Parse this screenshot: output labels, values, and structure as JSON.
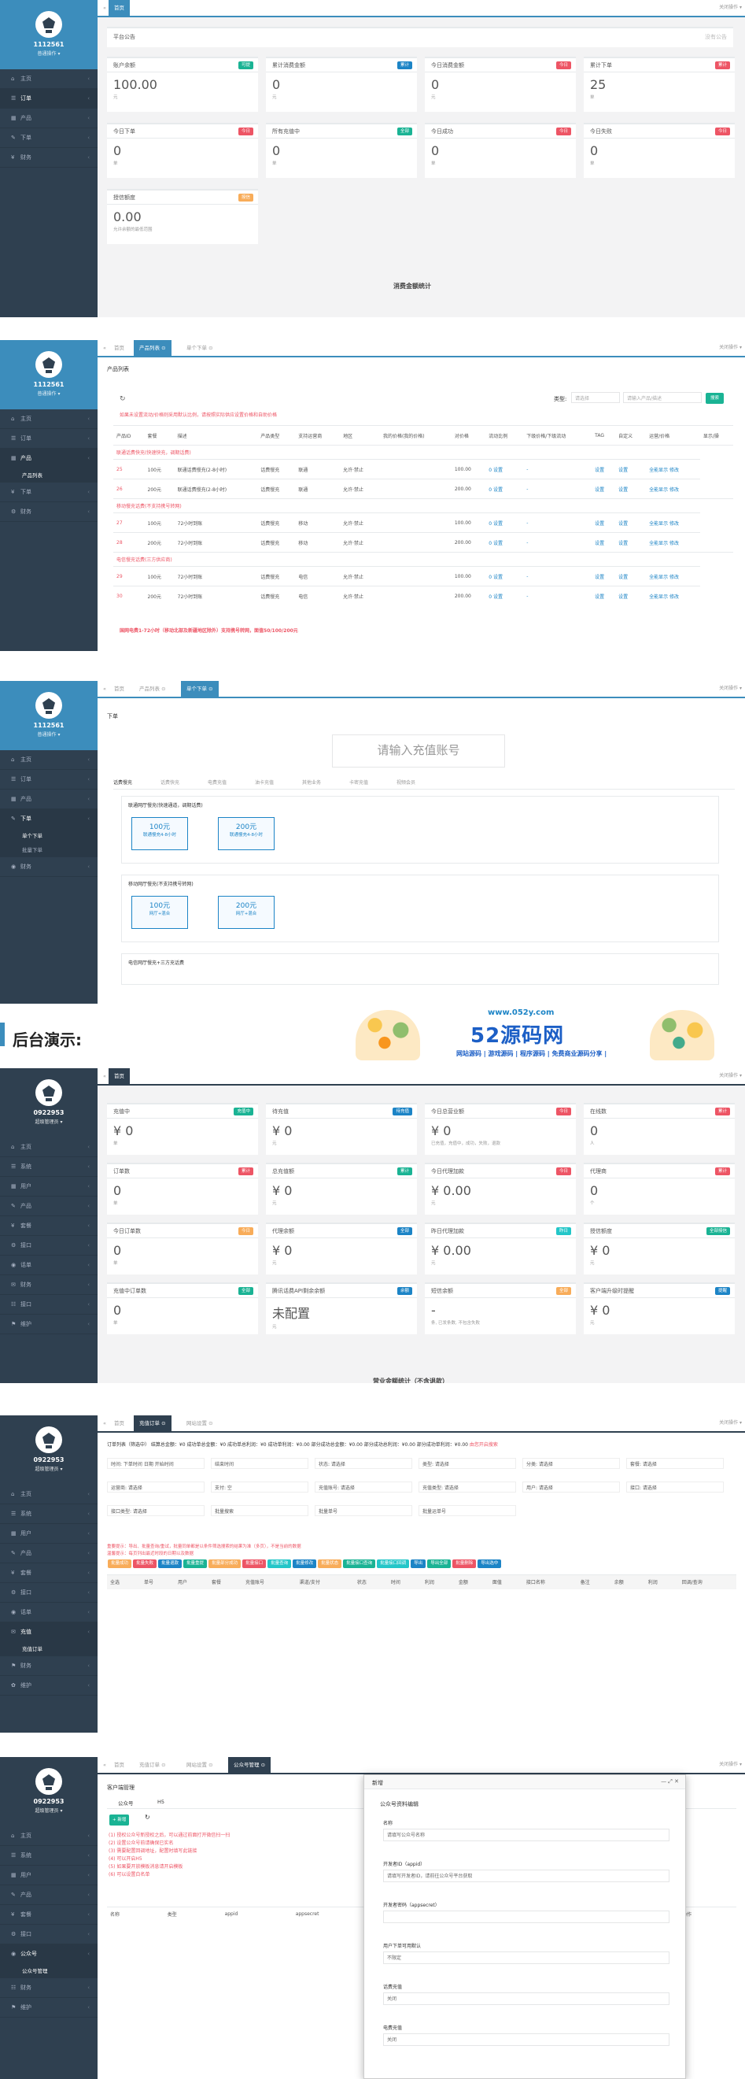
{
  "p1": {
    "user": "1112561",
    "role": "普通操作 ▾",
    "nav": [
      "主页",
      "订单",
      "产品",
      "下单",
      "财务"
    ],
    "tabs": [
      "首页"
    ],
    "tabr": "关闭操作 ▾",
    "notice": "平台公告",
    "notice_r": "没有公告",
    "cards": [
      {
        "t": "账户余额",
        "b": "可提",
        "v": "100.00",
        "s": "元"
      },
      {
        "t": "累计消费金额",
        "b": "累计",
        "v": "0",
        "s": "元"
      },
      {
        "t": "今日消费金额",
        "b": "今日",
        "v": "0",
        "s": "元"
      },
      {
        "t": "累计下单",
        "b": "累计",
        "v": "25",
        "s": "单"
      },
      {
        "t": "今日下单",
        "b": "今日",
        "v": "0",
        "s": "单"
      },
      {
        "t": "所有充值中",
        "b": "全部",
        "v": "0",
        "s": "单"
      },
      {
        "t": "今日成功",
        "b": "今日",
        "v": "0",
        "s": "单"
      },
      {
        "t": "今日失败",
        "b": "今日",
        "v": "0",
        "s": "单"
      },
      {
        "t": "授信额度",
        "b": "授信",
        "v": "0.00",
        "s": "允许余额的最低范围"
      }
    ],
    "footer": "消费金额统计"
  },
  "p2": {
    "user": "1112561",
    "role": "普通操作 ▾",
    "nav": [
      "主页",
      "订单",
      "产品",
      "产品列表",
      "下单",
      "财务"
    ],
    "tabs": [
      "首页",
      "产品列表 ⊙",
      "单个下单 ⊙"
    ],
    "tabr": "关闭操作 ▾",
    "title": "产品列表",
    "type_label": "类型:",
    "type_sel": "请选择",
    "kw": "请输入产品/描述",
    "search": "搜索",
    "warn": "如果未设置流动/价格则采用默认比例，请按照实际供应设置价格和自助价格",
    "headers": [
      "产品ID",
      "套餐",
      "描述",
      "产品类型",
      "支持运营商",
      "地区",
      "我的价格(我的价格)",
      "对价格",
      "流动比例",
      "下级价格/下级流动",
      "TAG",
      "自定义",
      "运营/价格",
      "显示/操"
    ],
    "groups": [
      {
        "name": "联通话费快充(快速快充，调期话费)",
        "rows": [
          [
            "25",
            "100元",
            "联通话费慢充(2-8小时)",
            "话费慢充",
            "联通",
            "允许·禁止",
            "",
            "100.00",
            "0 设置",
            "-",
            "设置",
            "设置",
            "全能显示 修改"
          ],
          [
            "26",
            "200元",
            "联通话费慢充(2-8小时)",
            "话费慢充",
            "联通",
            "允许·禁止",
            "",
            "200.00",
            "0 设置",
            "-",
            "设置",
            "设置",
            "全能显示 修改"
          ]
        ]
      },
      {
        "name": "移动慢充话费(不支持携号转网)",
        "rows": [
          [
            "27",
            "100元",
            "72小时到账",
            "话费慢充",
            "移动",
            "允许·禁止",
            "",
            "100.00",
            "0 设置",
            "-",
            "设置",
            "设置",
            "全能显示 修改"
          ],
          [
            "28",
            "200元",
            "72小时到账",
            "话费慢充",
            "移动",
            "允许·禁止",
            "",
            "200.00",
            "0 设置",
            "-",
            "设置",
            "设置",
            "全能显示 修改"
          ]
        ]
      },
      {
        "name": "电信慢充话费(三方供应商)",
        "rows": [
          [
            "29",
            "100元",
            "72小时到账",
            "话费慢充",
            "电信",
            "允许·禁止",
            "",
            "100.00",
            "0 设置",
            "-",
            "设置",
            "设置",
            "全能显示 修改"
          ],
          [
            "30",
            "200元",
            "72小时到账",
            "话费慢充",
            "电信",
            "允许·禁止",
            "",
            "200.00",
            "0 设置",
            "-",
            "设置",
            "设置",
            "全能显示 修改"
          ]
        ]
      }
    ],
    "foot": "国网电费1-72小时（移动北部及新疆地区除外）支持携号转网，面值50/100/200元"
  },
  "p3": {
    "user": "1112561",
    "role": "普通操作 ▾",
    "nav": [
      "主页",
      "订单",
      "产品",
      "下单",
      "单个下单",
      "批量下单",
      "财务"
    ],
    "tabs": [
      "首页",
      "产品列表 ⊙",
      "单个下单 ⊙"
    ],
    "tabr": "关闭操作 ▾",
    "title": "下单",
    "ph": "请输入充值账号",
    "subtabs": [
      "话费慢充",
      "话费快充",
      "电费充值",
      "油卡充值",
      "其他业务",
      "卡密充值",
      "视频会员"
    ],
    "boxes": [
      {
        "name": "联通网厅慢充(快速通道，调期话费)",
        "opts": [
          {
            "a": "100元",
            "b": "联通慢充4-8小时"
          },
          {
            "a": "200元",
            "b": "联通慢充4-8小时"
          }
        ]
      },
      {
        "name": "移动网厅慢充(不支持携号转网)",
        "opts": [
          {
            "a": "100元",
            "b": "网厅+混合"
          },
          {
            "a": "200元",
            "b": "网厅+混合"
          }
        ]
      },
      {
        "name": "电信网厅慢充+三方充话费",
        "opts": []
      }
    ]
  },
  "banner": {
    "label": "后台演示:",
    "site": "www.052y.com",
    "name": "52源码网",
    "slogan": "网站源码 | 游戏源码 | 程序源码 | 免费商业源码分享 |"
  },
  "p4": {
    "user": "0922953",
    "role": "超级管理员 ▾",
    "nav": [
      "主页",
      "系统",
      "用户",
      "产品",
      "套餐",
      "接口",
      "话单",
      "财务",
      "接口",
      "维护"
    ],
    "tabs": [
      "首页"
    ],
    "tabr": "关闭操作 ▾",
    "cards": [
      {
        "t": "充值中",
        "b": "充值中",
        "v": "¥ 0",
        "s": "单"
      },
      {
        "t": "待充值",
        "b": "待充值",
        "v": "¥ 0",
        "s": "元"
      },
      {
        "t": "今日总营业额",
        "b": "今日",
        "v": "¥ 0",
        "s": "已充值，充值中，成功，失败，退款"
      },
      {
        "t": "在线数",
        "b": "累计",
        "v": "0",
        "s": "人"
      },
      {
        "t": "订单数",
        "b": "累计",
        "v": "0",
        "s": "单"
      },
      {
        "t": "总充值额",
        "b": "累计",
        "v": "¥ 0",
        "s": "元"
      },
      {
        "t": "今日代理加款",
        "b": "今日",
        "v": "¥ 0.00",
        "s": "元"
      },
      {
        "t": "代理商",
        "b": "累计",
        "v": "0",
        "s": "个"
      },
      {
        "t": "今日订单数",
        "b": "今日",
        "v": "0",
        "s": "单"
      },
      {
        "t": "代理余额",
        "b": "全部",
        "v": "¥ 0",
        "s": "元"
      },
      {
        "t": "昨日代理加款",
        "b": "昨日",
        "v": "¥ 0.00",
        "s": "元"
      },
      {
        "t": "授信额度",
        "b": "全部授信",
        "v": "¥ 0",
        "s": "元"
      },
      {
        "t": "充值中订单数",
        "b": "全部",
        "v": "0",
        "s": "单"
      },
      {
        "t": "腾讯话费API剩余余额",
        "b": "余额",
        "v": "未配置",
        "s": "元"
      },
      {
        "t": "短信余额",
        "b": "全部",
        "v": "-",
        "s": "条, 已发条数, 不包含失败"
      },
      {
        "t": "客户端升级时提醒",
        "b": "提醒",
        "v": "¥ 0",
        "s": "元"
      }
    ],
    "footer": "营业金额统计（不含退款）"
  },
  "p5": {
    "user": "0922953",
    "role": "超级管理员 ▾",
    "nav": [
      "主页",
      "系统",
      "用户",
      "产品",
      "套餐",
      "接口",
      "话单",
      "充值",
      "充值订单",
      "财务",
      "维护"
    ],
    "tabs": [
      "首页",
      "充值订单 ⊙",
      "网站设置 ⊙"
    ],
    "tabr": "关闭操作 ▾",
    "stats": "订单列表（筛选中）  结算总金额：¥0  成功单总金额：¥0  成功单总利润：¥0  成功单利润：¥0.00  部分成功总金额：¥0.00  部分成功总利润：¥0.00  部分成功单利润：¥0.00",
    "stats_red": "由您开启搜索",
    "filters": [
      "时间: 下单时间  日期  开始时间",
      "结束时间",
      "状态: 请选择",
      "类型: 请选择",
      "分类: 请选择",
      "套餐: 请选择",
      "运营商: 请选择",
      "支付: 空",
      "充值账号: 请选择",
      "充值类型: 请选择",
      "用户: 请选择",
      "接口: 请选择",
      "接口类型: 请选择",
      "批量搜索",
      "批量单号",
      "批量运单号"
    ],
    "notice": [
      "重要提示：导出、批量查询/重试，批量同单都是以条件筛选搜索的结果为准（多页），不是当前的数据",
      "温馨提示：每页列出最近时段的日期以及数据"
    ],
    "buttons": [
      "批量成功",
      "批量失败",
      "批量退款",
      "批量重提",
      "批量部分成功",
      "批量接口",
      "批量查询",
      "批量修改",
      "批量状态",
      "批量接口查询",
      "批量接口回调",
      "导出",
      "导出全部",
      "批量删除",
      "导出选中"
    ],
    "headers": [
      "全选",
      "单号",
      "用户",
      "套餐",
      "充值账号",
      "渠道/支付",
      "状态",
      "时间",
      "利润",
      "金额",
      "面值",
      "接口名称",
      "备注",
      "余额",
      "利润",
      "回调/查询"
    ]
  },
  "p6": {
    "user": "0922953",
    "role": "超级管理员 ▾",
    "nav": [
      "主页",
      "系统",
      "用户",
      "产品",
      "套餐",
      "接口",
      "公众号",
      "公众号管理",
      "财务",
      "维护"
    ],
    "tabs": [
      "首页",
      "充值订单 ⊙",
      "网站设置 ⊙",
      "公众号管理 ⊙"
    ],
    "tabr": "关闭操作 ▾",
    "title": "客户端管理",
    "subtabs": [
      "公众号",
      "H5"
    ],
    "add": "+ 新增",
    "notes": [
      "(1) 授权公众号新授权之后，可以通过前面打开微信扫一扫",
      "(2) 设置公众号前请确保已实名",
      "(3) 需要配置回调地址，配置时填写此链接",
      "(4) 可以开启H5",
      "(5) 如果要开放模板消息请开启模板",
      "(6) 可以设置白名单"
    ],
    "headers": [
      "名称",
      "类型",
      "appid",
      "appsecret",
      "token",
      "encodingaeskey",
      "",
      "",
      "操作"
    ],
    "dialog": {
      "title": "新增",
      "section": "公众号资料编辑",
      "f1": "名称",
      "f1p": "请填写公众号名称",
      "f2": "开发者ID（appid）",
      "f2p": "请填写开发者ID，请前往公众号平台获取",
      "f3": "开发者密码（appsecret）",
      "f4": "用户下单可用默认",
      "f4v": "不限定",
      "f5": "话费充值",
      "f5v": "关闭",
      "f6": "电费充值",
      "f6v": "关闭"
    }
  }
}
